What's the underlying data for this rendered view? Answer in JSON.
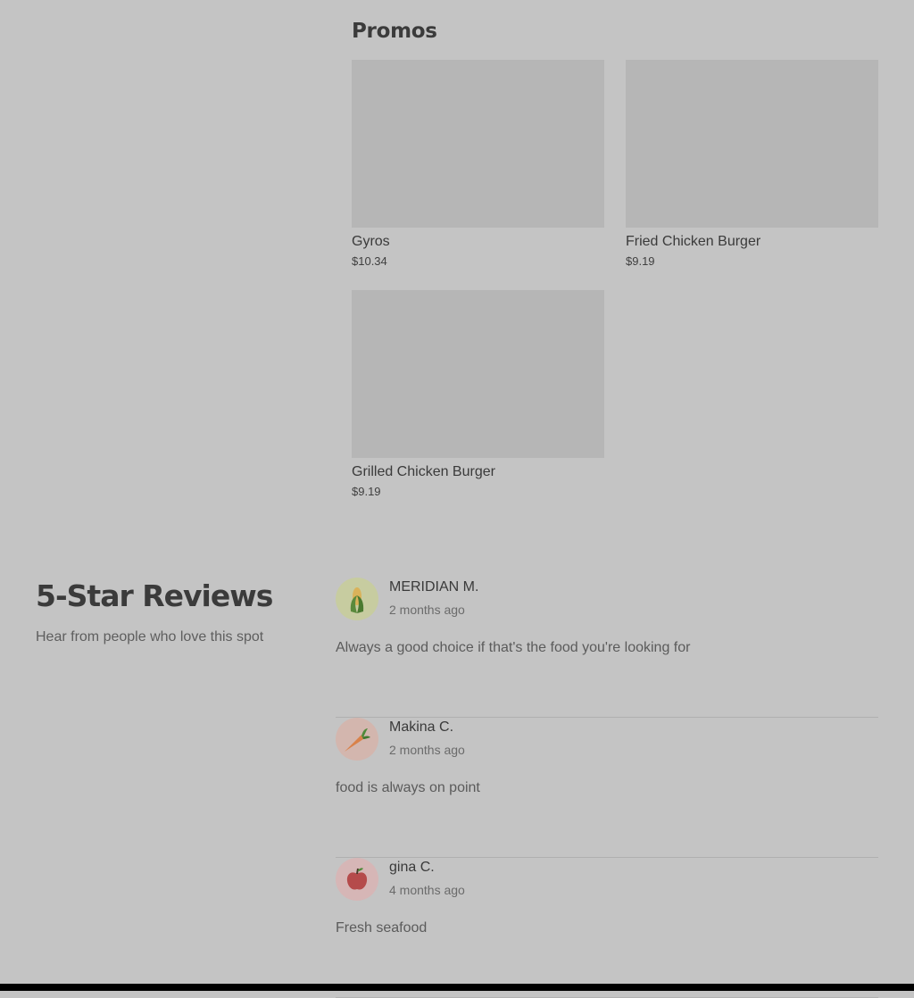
{
  "promos": {
    "title": "Promos",
    "items": [
      {
        "name": "Gyros",
        "price": "$10.34"
      },
      {
        "name": "Fried Chicken Burger",
        "price": "$9.19"
      },
      {
        "name": "Grilled Chicken Burger",
        "price": "$9.19"
      }
    ]
  },
  "reviews": {
    "heading": "5-Star Reviews",
    "subheading": "Hear from people who love this spot",
    "items": [
      {
        "name": "MERIDIAN M.",
        "date": "2 months ago",
        "text": "Always a good choice if that's the food you're looking for",
        "avatar_icon": "corn-icon",
        "avatar_color": "#c7cca0"
      },
      {
        "name": "Makina C.",
        "date": "2 months ago",
        "text": "food is always on point",
        "avatar_icon": "carrot-icon",
        "avatar_color": "#d3b6ae"
      },
      {
        "name": "gina C.",
        "date": "4 months ago",
        "text": "Fresh seafood",
        "avatar_icon": "apple-icon",
        "avatar_color": "#d6b6b6"
      }
    ]
  },
  "colors": {
    "background": "#c4c4c4",
    "image_placeholder": "#b6b6b6",
    "bottom_bar": "#000000"
  }
}
